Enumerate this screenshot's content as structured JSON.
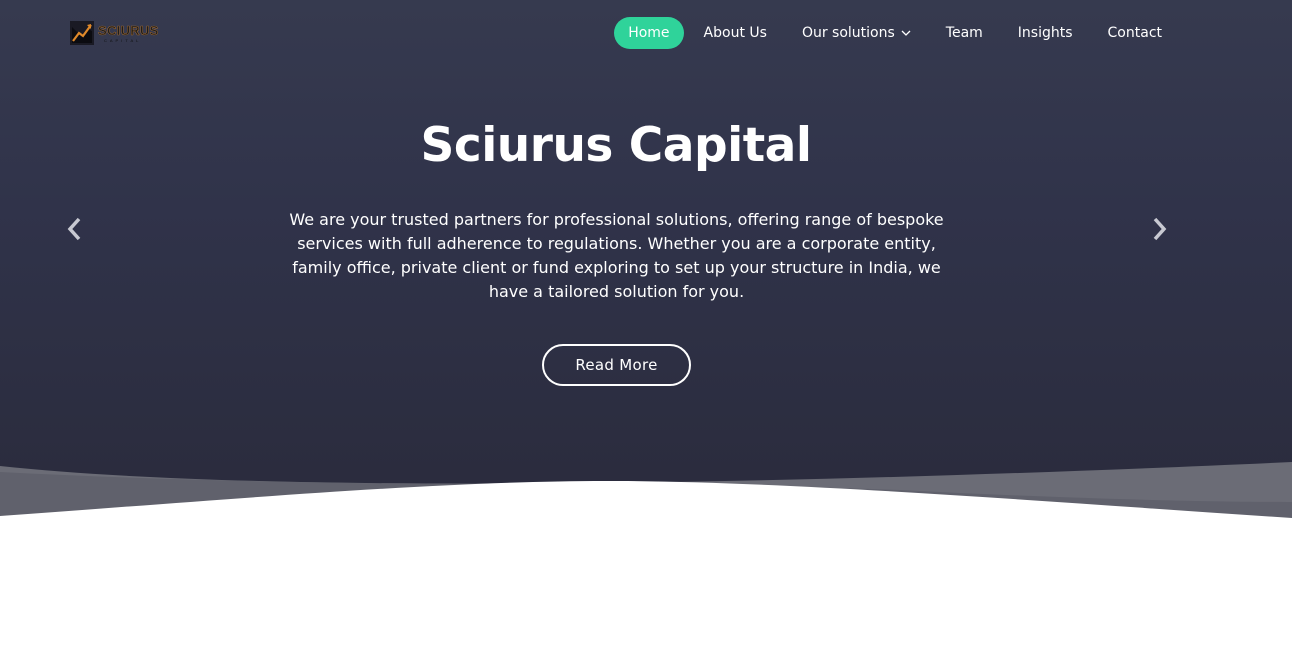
{
  "brand": {
    "name": "SCIURUS",
    "sub": "CAPITAL",
    "accent": "#e0892a"
  },
  "nav": {
    "items": [
      {
        "label": "Home",
        "active": true
      },
      {
        "label": "About Us"
      },
      {
        "label": "Our solutions",
        "has_dropdown": true
      },
      {
        "label": "Team"
      },
      {
        "label": "Insights"
      },
      {
        "label": "Contact"
      }
    ],
    "active_color": "#2fd39a"
  },
  "hero": {
    "title": "Sciurus Capital",
    "description": "We are your trusted partners for professional solutions, offering range of bespoke services with full adherence to regulations. Whether you are a corporate entity, family office, private client or fund exploring to set up your structure in India, we have a tailored solution for you.",
    "cta_label": "Read More",
    "prev_icon": "chevron-left-icon",
    "next_icon": "chevron-right-icon",
    "background": "#30334a"
  }
}
